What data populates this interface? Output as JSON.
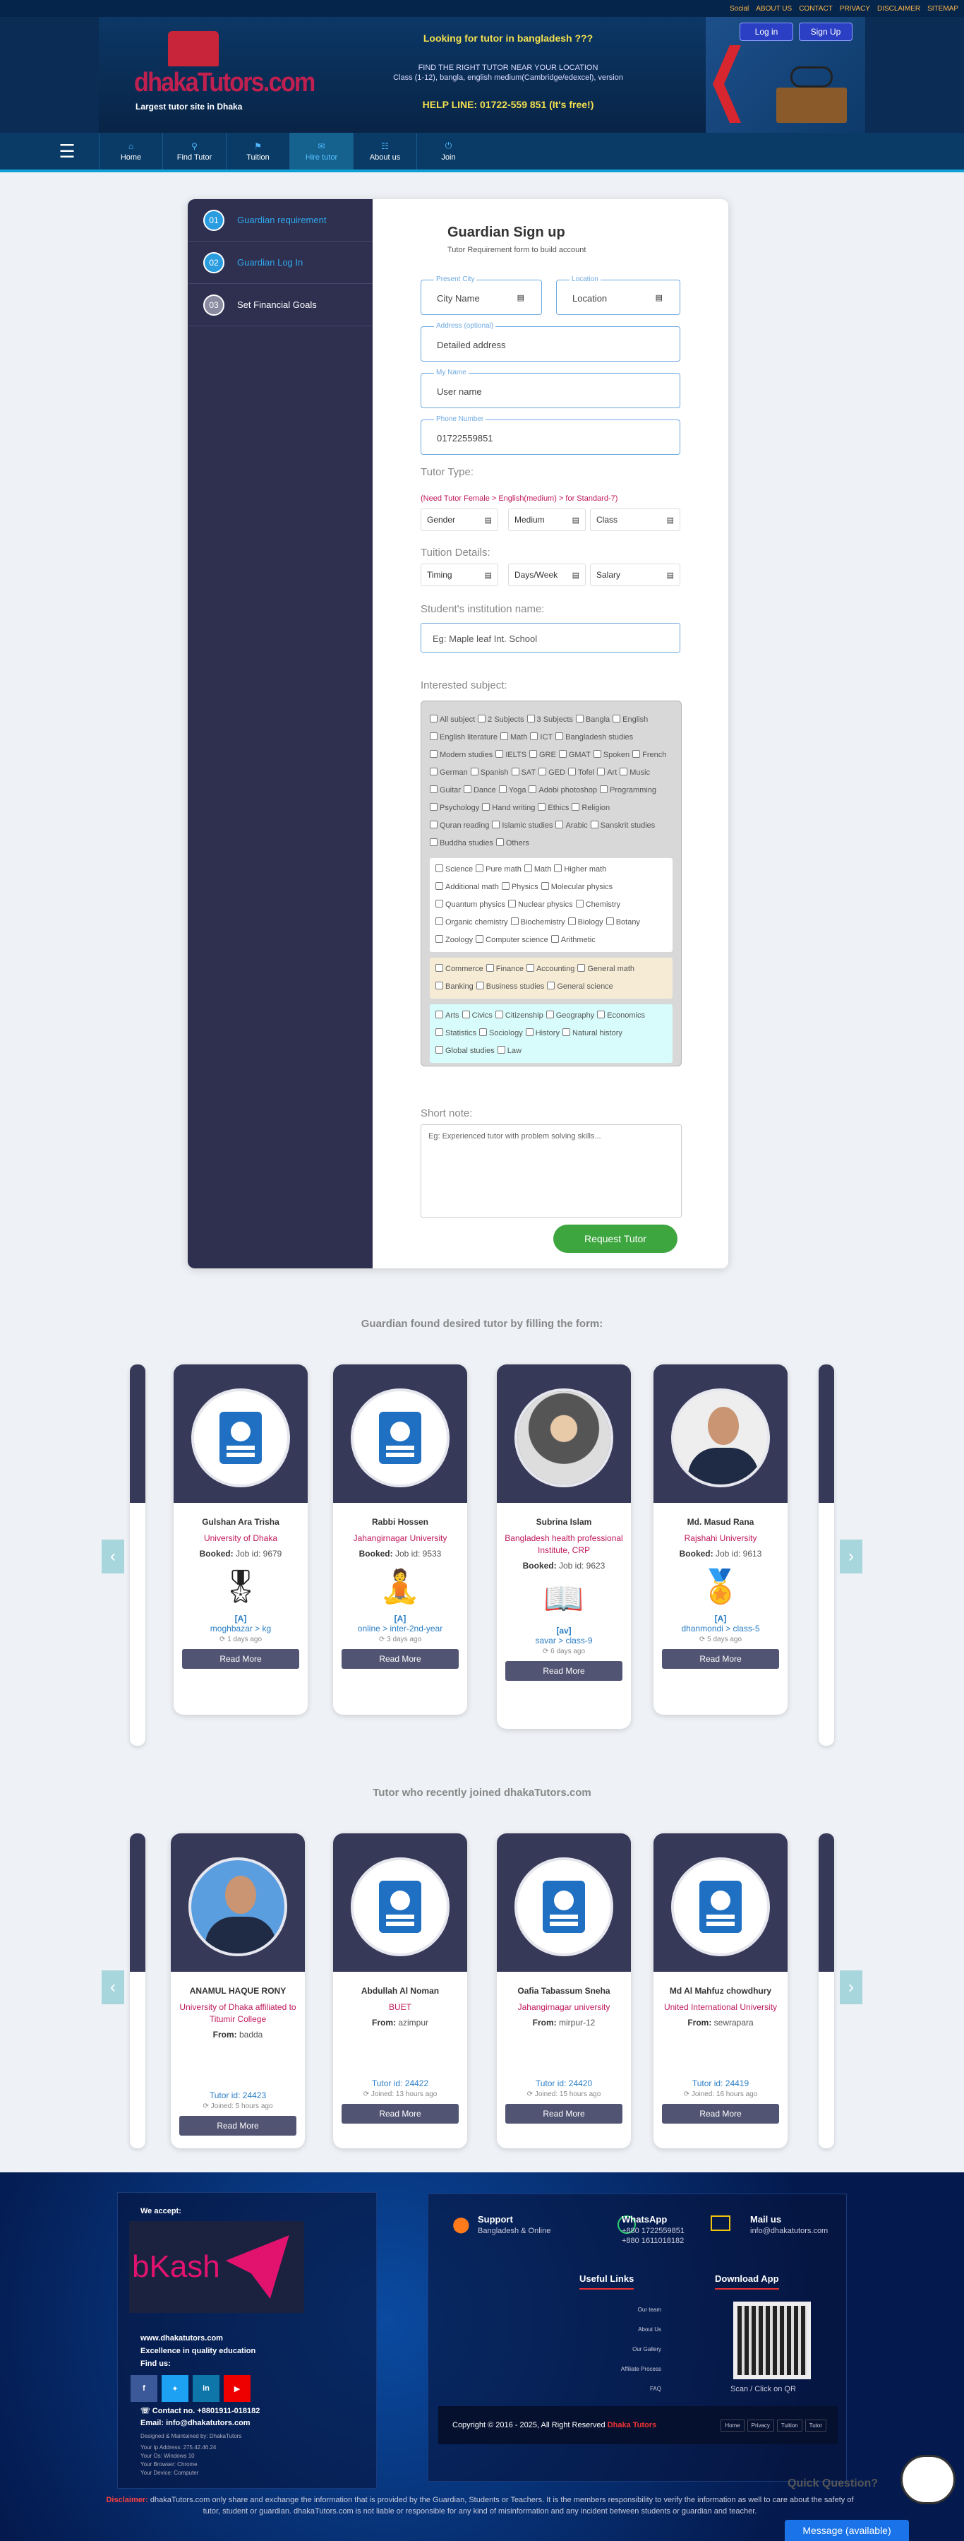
{
  "topbar": {
    "links": [
      "Social",
      "ABOUT US",
      "CONTACT",
      "PRIVACY",
      "DISCLAIMER",
      "SITEMAP"
    ]
  },
  "header": {
    "logo_word": "dhakaTutors.com",
    "logo_tag": "Largest tutor site in Dhaka",
    "headline": "Looking for tutor in bangladesh ???",
    "line1": "FIND THE RIGHT TUTOR NEAR YOUR LOCATION",
    "line2": "Class (1-12), bangla, english medium(Cambridge/edexcel), version",
    "helpline": "HELP LINE: 01722-559 851 (It's free!)",
    "login": "Log in",
    "signup": "Sign Up"
  },
  "nav": {
    "items": [
      {
        "icon": "⌂",
        "label": "Home"
      },
      {
        "icon": "⚲",
        "label": "Find Tutor"
      },
      {
        "icon": "⚑",
        "label": "Tuition"
      },
      {
        "icon": "✉",
        "label": "Hire tutor"
      },
      {
        "icon": "☷",
        "label": "About us"
      },
      {
        "icon": "⏻",
        "label": "Join"
      }
    ],
    "active": "Hire tutor"
  },
  "steps": [
    {
      "num": "01",
      "label": "Guardian requirement"
    },
    {
      "num": "02",
      "label": "Guardian Log In"
    },
    {
      "num": "03",
      "label": "Set Financial Goals"
    }
  ],
  "form": {
    "title": "Guardian Sign up",
    "subtitle": "Tutor Requirement form to build account",
    "city_legend": "Present City",
    "city": "City Name",
    "loc_legend": "Location",
    "location": "Location",
    "addr_legend": "Address (optional)",
    "address": "Detailed address",
    "name_legend": "My Name",
    "name": "User name",
    "phone_legend": "Phone Number",
    "phone": "01722559851",
    "tutor_type": "Tutor Type:",
    "tutor_hint": "(Need Tutor Female > English(medium) > for Standard-7)",
    "gender": "Gender",
    "medium": "Medium",
    "klass": "Class",
    "tuition_details": "Tuition Details:",
    "timing": "Timing",
    "days": "Days/Week",
    "salary": "Salary",
    "institution_label": "Student's institution name:",
    "institution_placeholder": "Eg: Maple leaf Int. School",
    "interested": "Interested subject:",
    "subjects_main": [
      "All subject",
      "2 Subjects",
      "3 Subjects",
      "Bangla",
      "English",
      "English literature",
      "Math",
      "ICT",
      "Bangladesh studies",
      "Modern studies",
      "IELTS",
      "GRE",
      "GMAT",
      "Spoken",
      "French",
      "German",
      "Spanish",
      "SAT",
      "GED",
      "Tofel",
      "Art",
      "Music",
      "Guitar",
      "Dance",
      "Yoga",
      "Adobi photoshop",
      "Programming",
      "Psychology",
      "Hand writing",
      "Ethics",
      "Religion",
      "Quran reading",
      "Islamic studies",
      "Arabic",
      "Sanskrit studies",
      "Buddha studies",
      "Others"
    ],
    "subjects_science": [
      "Science",
      "Pure math",
      "Math",
      "Higher math",
      "Additional math",
      "Physics",
      "Molecular physics",
      "Quantum physics",
      "Nuclear physics",
      "Chemistry",
      "Organic chemistry",
      "Biochemistry",
      "Biology",
      "Botany",
      "Zoology",
      "Computer science",
      "Arithmetic"
    ],
    "subjects_commerce": [
      "Commerce",
      "Finance",
      "Accounting",
      "General math",
      "Banking",
      "Business studies",
      "General science"
    ],
    "subjects_arts": [
      "Arts",
      "Civics",
      "Citizenship",
      "Geography",
      "Economics",
      "Statistics",
      "Sociology",
      "History",
      "Natural history",
      "Global studies",
      "Law"
    ],
    "note_label": "Short note:",
    "note_placeholder": "Eg: Experienced tutor with problem solving skills...",
    "submit": "Request Tutor"
  },
  "booked": {
    "heading": "Guardian found desired tutor by filling the form:",
    "read_more": "Read More",
    "cards": [
      {
        "name": "Gulshan Ara Trisha",
        "uni": "University of Dhaka",
        "booked_label": "Booked:",
        "job": "Job id: 9679",
        "grade": "[A]",
        "area": "moghbazar > kg",
        "ago": "1 days ago",
        "photo": "doc",
        "badge": "🎖"
      },
      {
        "name": "Rabbi Hossen",
        "uni": "Jahangirnagar University",
        "booked_label": "Booked:",
        "job": "Job id: 9533",
        "grade": "[A]",
        "area": "online > inter-2nd-year",
        "ago": "3 days ago",
        "photo": "doc",
        "badge": "🧘"
      },
      {
        "name": "Subrina Islam",
        "uni": "Bangladesh health professional Institute, CRP",
        "booked_label": "Booked:",
        "job": "Job id: 9623",
        "grade": "[av]",
        "area": "savar > class-9",
        "ago": "6 days ago",
        "photo": "hijab",
        "badge": "📖"
      },
      {
        "name": "Md. Masud Rana",
        "uni": "Rajshahi University",
        "booked_label": "Booked:",
        "job": "Job id: 9613",
        "grade": "[A]",
        "area": "dhanmondi > class-5",
        "ago": "5 days ago",
        "photo": "male",
        "badge": "🏅"
      }
    ]
  },
  "joined": {
    "heading": "Tutor who recently joined dhakaTutors.com",
    "read_more": "Read More",
    "from_label": "From:",
    "cards": [
      {
        "name": "ANAMUL HAQUE RONY",
        "uni": "University of Dhaka affiliated to Titumir College",
        "from": "badda",
        "tutor": "Tutor id: 24423",
        "ago": "Joined: 5 hours ago",
        "photo": "male2"
      },
      {
        "name": "Abdullah Al Noman",
        "uni": "BUET",
        "from": "azimpur",
        "tutor": "Tutor id: 24422",
        "ago": "Joined: 13 hours ago",
        "photo": "doc"
      },
      {
        "name": "Oafia Tabassum Sneha",
        "uni": "Jahangirnagar university",
        "from": "mirpur-12",
        "tutor": "Tutor id: 24420",
        "ago": "Joined: 15 hours ago",
        "photo": "doc"
      },
      {
        "name": "Md Al Mahfuz chowdhury",
        "uni": "United International University",
        "from": "sewrapara",
        "tutor": "Tutor id: 24419",
        "ago": "Joined: 16 hours ago",
        "photo": "doc"
      }
    ]
  },
  "footer": {
    "we_accept": "We accept:",
    "bkash": "bKash",
    "site": "www.dhakatutors.com",
    "excellence": "Excellence in quality education",
    "find_us": "Find us:",
    "contact": "☏ Contact no. +8801911-018182",
    "email": "Email: info@dhakatutors.com",
    "designed": "Designed & Maintained by: DhakaTutors",
    "ip": "Your Ip Address: 275.42.46.24",
    "os": "Your Os: Windows 10",
    "browser": "Your Browser: Chrome",
    "device": "Your Device: Computer",
    "support_title": "Support",
    "support_sub": "Bangladesh & Online",
    "wa_title": "WhatsApp",
    "wa_1": "+880 1722559851",
    "wa_2": "+880 1611018182",
    "mail_title": "Mail us",
    "mail_sub": "info@dhakatutors.com",
    "useful": "Useful Links",
    "useful_items": [
      "Our team",
      "About Us",
      "Our Gallery",
      "Affiliate Process",
      "FAQ"
    ],
    "app": "Download App",
    "qr": "Scan / Click on QR",
    "copyright": "Copyright © 2016 - 2025, All Right Reserved",
    "brand": "Dhaka Tutors",
    "bottom_links": [
      "Home",
      "Privacy",
      "Tuition",
      "Tutor"
    ],
    "disc_label": "Disclaimer:",
    "disclaimer": "dhakaTutors.com only share and exchange the information that is provided by the Guardian, Students or Teachers. It is the members responsibility to verify the information as well to care about the safety of tutor, student or guardian. dhakaTutors.com is not liable or responsible for any kind of misinformation and any incident between students or guardian and teacher.",
    "quick": "Quick Question?",
    "message": "Message (available)"
  },
  "colors": {
    "nav": "#0a3b66",
    "accent": "#2a9de0",
    "card_dark": "#373958",
    "green": "#3ea63f",
    "red_text": "#c0185b"
  }
}
